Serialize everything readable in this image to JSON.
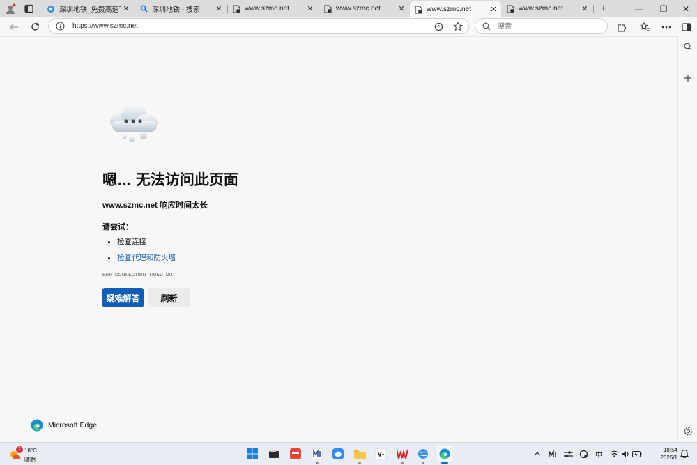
{
  "tabs": [
    {
      "title": "深圳地铁_免费高速下载|",
      "favicon": "app-logo-icon"
    },
    {
      "title": "深圳地铁 - 搜索",
      "favicon": "search-icon"
    },
    {
      "title": "www.szmc.net",
      "favicon": "page-error-icon"
    },
    {
      "title": "www.szmc.net",
      "favicon": "page-error-icon"
    },
    {
      "title": "www.szmc.net",
      "favicon": "page-error-icon",
      "active": true
    },
    {
      "title": "www.szmc.net",
      "favicon": "page-error-icon"
    }
  ],
  "tab_close_glyph": "✕",
  "new_tab_glyph": "+",
  "window_controls": {
    "minimize": "—",
    "restore": "❐",
    "close": "✕"
  },
  "address_bar": {
    "url": "https://www.szmc.net"
  },
  "search_box": {
    "placeholder": "搜索"
  },
  "error_page": {
    "headline": "嗯… 无法访问此页面",
    "subline": "www.szmc.net 响应时间太长",
    "try_label": "请尝试：",
    "suggestions": [
      {
        "text": "检查连接",
        "link": false
      },
      {
        "text": "检查代理和防火墙",
        "link": true
      }
    ],
    "error_code": "ERR_CONNECTION_TIMED_OUT",
    "help_button": "疑难解答",
    "refresh_button": "刷新",
    "brand": "Microsoft Edge"
  },
  "taskbar": {
    "weather": {
      "badge": "2",
      "temp": "18°C",
      "condition": "晴朗"
    },
    "apps": [
      "start-icon",
      "file-manager-icon",
      "red-app-icon",
      "chart-app-icon",
      "cloud-app-icon",
      "file-explorer-icon",
      "vscode-like-icon",
      "wps-icon",
      "browser-globe-icon",
      "edge-icon"
    ],
    "ime": "中",
    "clock": {
      "time": "18:54",
      "date": "2025/1"
    }
  },
  "colors": {
    "accent": "#0f5fb8",
    "link": "#1a5fb4",
    "tab_strip": "#dcdcdc",
    "page_bg": "#f7f7f7"
  }
}
